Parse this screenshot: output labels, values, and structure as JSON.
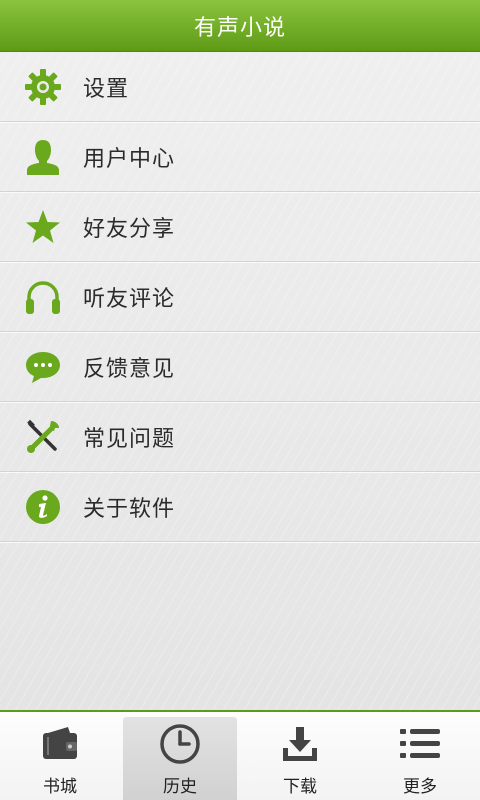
{
  "header": {
    "title": "有声小说"
  },
  "menu": {
    "items": [
      {
        "label": "设置",
        "icon": "gear-icon"
      },
      {
        "label": "用户中心",
        "icon": "user-icon"
      },
      {
        "label": "好友分享",
        "icon": "star-icon"
      },
      {
        "label": "听友评论",
        "icon": "headphones-icon"
      },
      {
        "label": "反馈意见",
        "icon": "chat-bubble-icon"
      },
      {
        "label": "常见问题",
        "icon": "tools-icon"
      },
      {
        "label": "关于软件",
        "icon": "info-icon"
      }
    ]
  },
  "tabs": [
    {
      "label": "书城",
      "icon": "wallet-icon",
      "active": false
    },
    {
      "label": "历史",
      "icon": "clock-icon",
      "active": true
    },
    {
      "label": "下载",
      "icon": "download-icon",
      "active": false
    },
    {
      "label": "更多",
      "icon": "list-icon",
      "active": false
    }
  ],
  "colors": {
    "accent": "#6aa81d",
    "icon_dark": "#444444"
  }
}
